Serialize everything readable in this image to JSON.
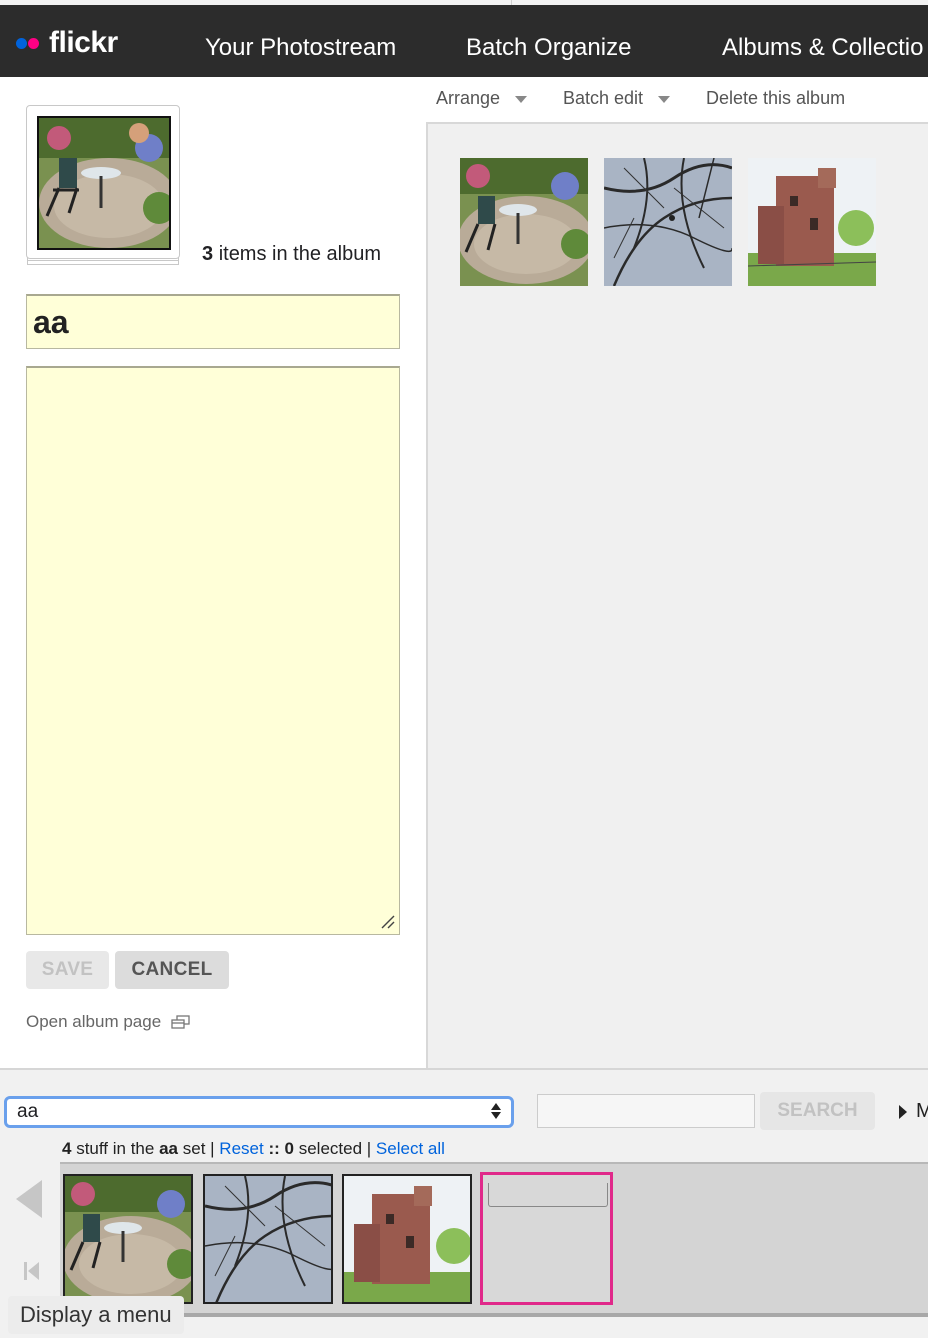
{
  "nav": {
    "logo_text": "flickr",
    "links": [
      "Your Photostream",
      "Batch Organize",
      "Albums & Collectio"
    ]
  },
  "toolbar": {
    "arrange": "Arrange",
    "batch_edit": "Batch edit",
    "delete_album": "Delete this album"
  },
  "album": {
    "item_count": "3",
    "items_suffix": "items in the album",
    "title_value": "aa",
    "description_value": "",
    "save_label": "SAVE",
    "cancel_label": "CANCEL",
    "open_album_label": "Open album page"
  },
  "organizer": {
    "set_select_value": "aa",
    "search_placeholder": "",
    "search_label": "SEARCH",
    "more_label": "M",
    "status": {
      "count": "4",
      "text1": "stuff in the",
      "set_name": "aa",
      "text2": "set |",
      "reset_label": "Reset",
      "sep": "::",
      "selected_count": "0",
      "selected_text": "selected |",
      "select_all_label": "Select all"
    },
    "tooltip": "Display a menu"
  },
  "colors": {
    "nav_bg": "#2c2c2c",
    "accent_blue": "#0063dc",
    "accent_pink": "#ff0084",
    "yellow_field": "#ffffd8",
    "selection_border": "#e0298a"
  }
}
